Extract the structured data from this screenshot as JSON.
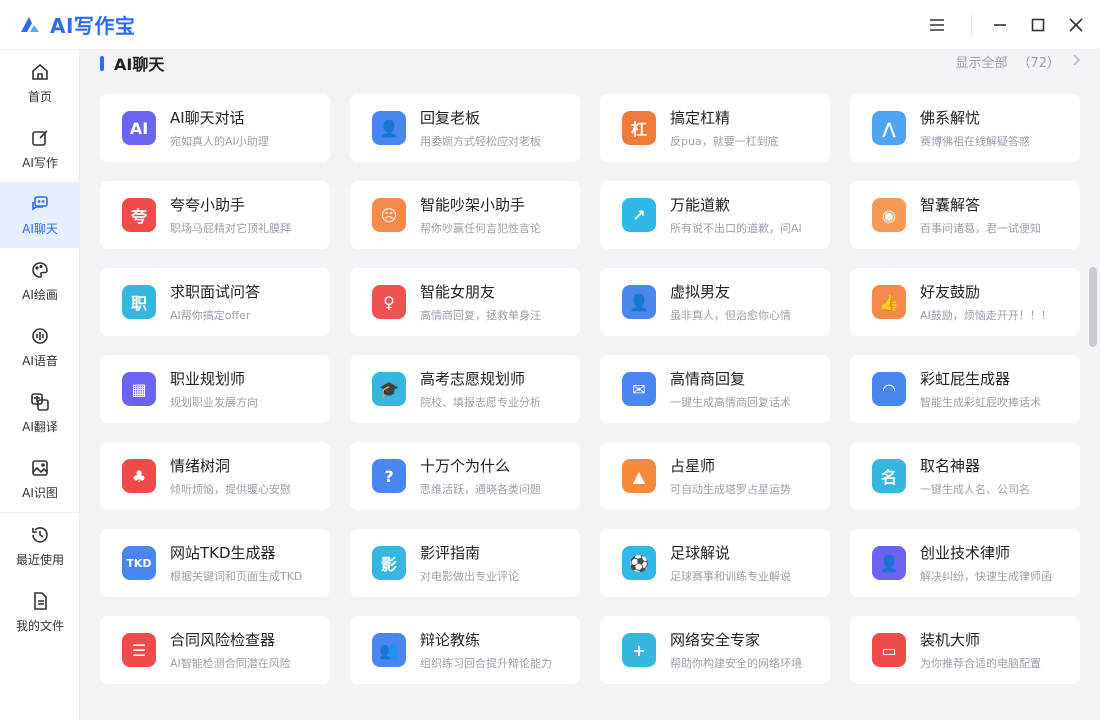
{
  "app": {
    "name": "AI写作宝",
    "accent": "#2a6df4"
  },
  "window": {
    "menu_icon": "menu-icon",
    "min_icon": "minimize-icon",
    "max_icon": "maximize-icon",
    "close_icon": "close-icon"
  },
  "sidebar": {
    "items": [
      {
        "label": "首页",
        "icon": "home-icon",
        "active": false
      },
      {
        "label": "AI写作",
        "icon": "edit-icon",
        "active": false
      },
      {
        "label": "AI聊天",
        "icon": "chat-icon",
        "active": true
      },
      {
        "label": "AI绘画",
        "icon": "palette-icon",
        "active": false
      },
      {
        "label": "AI语音",
        "icon": "voice-icon",
        "active": false
      },
      {
        "label": "AI翻译",
        "icon": "translate-icon",
        "active": false
      },
      {
        "label": "AI识图",
        "icon": "image-recognition-icon",
        "active": false
      },
      {
        "label": "最近使用",
        "icon": "history-icon",
        "active": false
      },
      {
        "label": "我的文件",
        "icon": "file-icon",
        "active": false
      }
    ]
  },
  "section": {
    "title": "AI聊天",
    "show_all": "显示全部",
    "count": "（72）"
  },
  "cards": [
    {
      "title": "AI聊天对话",
      "sub": "宛如真人的AI小助理",
      "color": "#6c63f0",
      "glyph": "AI"
    },
    {
      "title": "回复老板",
      "sub": "用委婉方式轻松应对老板",
      "color": "#4a86f0",
      "glyph": "👤"
    },
    {
      "title": "搞定杠精",
      "sub": "反pua，就要一杠到底",
      "color": "#f07a3a",
      "glyph": "杠"
    },
    {
      "title": "佛系解忧",
      "sub": "赛博佛祖在线解疑答惑",
      "color": "#4ea3f2",
      "glyph": "⋀"
    },
    {
      "title": "夸夸小助手",
      "sub": "职场马屁精对它顶礼膜拜",
      "color": "#ef4b4b",
      "glyph": "夸"
    },
    {
      "title": "智能吵架小助手",
      "sub": "帮你吵赢任何言犯性言论",
      "color": "#f58a4a",
      "glyph": "☹"
    },
    {
      "title": "万能道歉",
      "sub": "所有说不出口的道歉，问AI",
      "color": "#2fb8e8",
      "glyph": "↗"
    },
    {
      "title": "智囊解答",
      "sub": "百事问诸葛，君一试便知",
      "color": "#f79a55",
      "glyph": "◉"
    },
    {
      "title": "求职面试问答",
      "sub": "AI帮你搞定offer",
      "color": "#35b7e0",
      "glyph": "职"
    },
    {
      "title": "智能女朋友",
      "sub": "高情商回复，拯救单身汪",
      "color": "#f0534f",
      "glyph": "♀"
    },
    {
      "title": "虚拟男友",
      "sub": "虽非真人，但治愈你心情",
      "color": "#4a86f0",
      "glyph": "👤"
    },
    {
      "title": "好友鼓励",
      "sub": "AI鼓励，烦恼走开开！！！",
      "color": "#f78a4a",
      "glyph": "👍"
    },
    {
      "title": "职业规划师",
      "sub": "规划职业发展方向",
      "color": "#6c63f0",
      "glyph": "▦"
    },
    {
      "title": "高考志愿规划师",
      "sub": "院校、填报志愿专业分析",
      "color": "#35b7e0",
      "glyph": "🎓"
    },
    {
      "title": "高情商回复",
      "sub": "一键生成高情商回复话术",
      "color": "#4a86f0",
      "glyph": "✉"
    },
    {
      "title": "彩虹屁生成器",
      "sub": "智能生成彩虹屁吹捧话术",
      "color": "#4a86f0",
      "glyph": "◠"
    },
    {
      "title": "情绪树洞",
      "sub": "倾听烦恼，提供暖心安慰",
      "color": "#ef4b4b",
      "glyph": "♣"
    },
    {
      "title": "十万个为什么",
      "sub": "思维活跃，通晓各类问题",
      "color": "#4a86f0",
      "glyph": "?"
    },
    {
      "title": "占星师",
      "sub": "可自动生成塔罗占星运势",
      "color": "#f58a3a",
      "glyph": "▲"
    },
    {
      "title": "取名神器",
      "sub": "一键生成人名、公司名",
      "color": "#35b7e0",
      "glyph": "名"
    },
    {
      "title": "网站TKD生成器",
      "sub": "根据关键词和页面生成TKD",
      "color": "#4a86f0",
      "glyph": "TKD"
    },
    {
      "title": "影评指南",
      "sub": "对电影做出专业评论",
      "color": "#35b7e0",
      "glyph": "影"
    },
    {
      "title": "足球解说",
      "sub": "足球赛事和训练专业解说",
      "color": "#2fb8e8",
      "glyph": "⚽"
    },
    {
      "title": "创业技术律师",
      "sub": "解决纠纷，快速生成律师函",
      "color": "#6c63f0",
      "glyph": "👤"
    },
    {
      "title": "合同风险检查器",
      "sub": "AI智能检测合同潜在风险",
      "color": "#ef4b4b",
      "glyph": "☰"
    },
    {
      "title": "辩论教练",
      "sub": "组织练习回合提升辩论能力",
      "color": "#4a86f0",
      "glyph": "👥"
    },
    {
      "title": "网络安全专家",
      "sub": "帮助你构建安全的网络环境",
      "color": "#35b7e0",
      "glyph": "+"
    },
    {
      "title": "装机大师",
      "sub": "为你推荐合适的电脑配置",
      "color": "#ef4b4b",
      "glyph": "▭"
    }
  ]
}
